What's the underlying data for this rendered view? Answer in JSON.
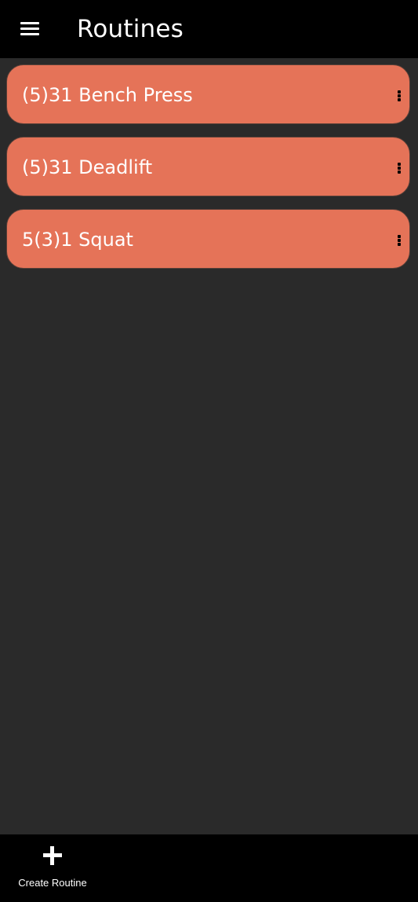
{
  "header": {
    "title": "Routines",
    "menu_icon": "hamburger-menu-icon"
  },
  "routines": [
    {
      "label": "(5)31 Bench Press",
      "more_icon": "more-vertical-icon"
    },
    {
      "label": "(5)31 Deadlift",
      "more_icon": "more-vertical-icon"
    },
    {
      "label": "5(3)1 Squat",
      "more_icon": "more-vertical-icon"
    }
  ],
  "bottom_bar": {
    "create_label": "Create Routine",
    "create_icon": "plus-icon"
  },
  "colors": {
    "background": "#2a2a2a",
    "bar": "#000000",
    "card": "#e57358",
    "text": "#ffffff"
  }
}
